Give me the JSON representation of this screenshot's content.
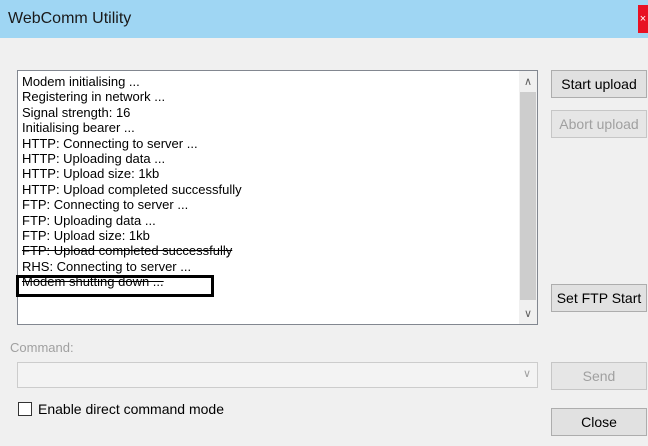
{
  "window": {
    "title": "WebComm Utility",
    "close_glyph": "×"
  },
  "log": {
    "lines": [
      "Modem initialising ...",
      "Registering in network ...",
      "Signal strength: 16",
      "Initialising bearer ...",
      "HTTP: Connecting to server ...",
      "HTTP: Uploading data ...",
      "HTTP: Upload size: 1kb",
      "HTTP: Upload completed successfully",
      "FTP: Connecting to server ...",
      "FTP: Uploading data ...",
      "FTP: Upload size: 1kb",
      "FTP: Upload completed successfully",
      "RHS: Connecting to server ...",
      "Modem shutting down ..."
    ],
    "scroll_up_glyph": "∧",
    "scroll_down_glyph": "∨"
  },
  "buttons": {
    "start_upload": "Start upload",
    "abort_upload": "Abort upload",
    "set_ftp_start": "Set FTP Start",
    "send": "Send",
    "close": "Close"
  },
  "command": {
    "label": "Command:",
    "value": "",
    "dropdown_glyph": "∨"
  },
  "checkbox": {
    "label": "Enable direct command mode",
    "checked": false
  }
}
